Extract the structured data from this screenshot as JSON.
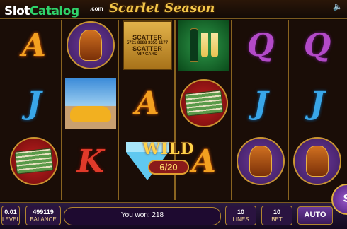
{
  "header": {
    "logo_part1": "Slot",
    "logo_part2": "Catalog",
    "logo_suffix": ".com",
    "game_title": "Scarlet Season",
    "sound_icon": "speaker-icon"
  },
  "reels": [
    [
      "A",
      "J",
      "cash-stack"
    ],
    [
      "cognac",
      "sports-car",
      "K"
    ],
    [
      "scatter-card",
      "A",
      "diamond-wild"
    ],
    [
      "champagne",
      "cash-stack",
      "A"
    ],
    [
      "Q",
      "J",
      "cognac"
    ]
  ],
  "scatter_card": {
    "label1": "SCATTER",
    "label2": "SCATTER",
    "digits": "5721 8888 3355 1177",
    "vip": "VIP CARD"
  },
  "wild": {
    "label": "WILD",
    "counter": "6/20"
  },
  "controls": {
    "bet_value": "0.01",
    "bet_label": "LEVEL",
    "balance_value": "499119",
    "balance_label": "BALANCE",
    "win_text": "You won: 218",
    "lines_value": "10",
    "lines_label": "LINES",
    "bet2_value": "10",
    "bet2_label": "BET",
    "auto_label": "AUTO",
    "spin_label": "S"
  },
  "colors": {
    "frame_gold": "#8a6420",
    "title_gold": "#f2c64a",
    "control_purple": "#2a1340"
  }
}
